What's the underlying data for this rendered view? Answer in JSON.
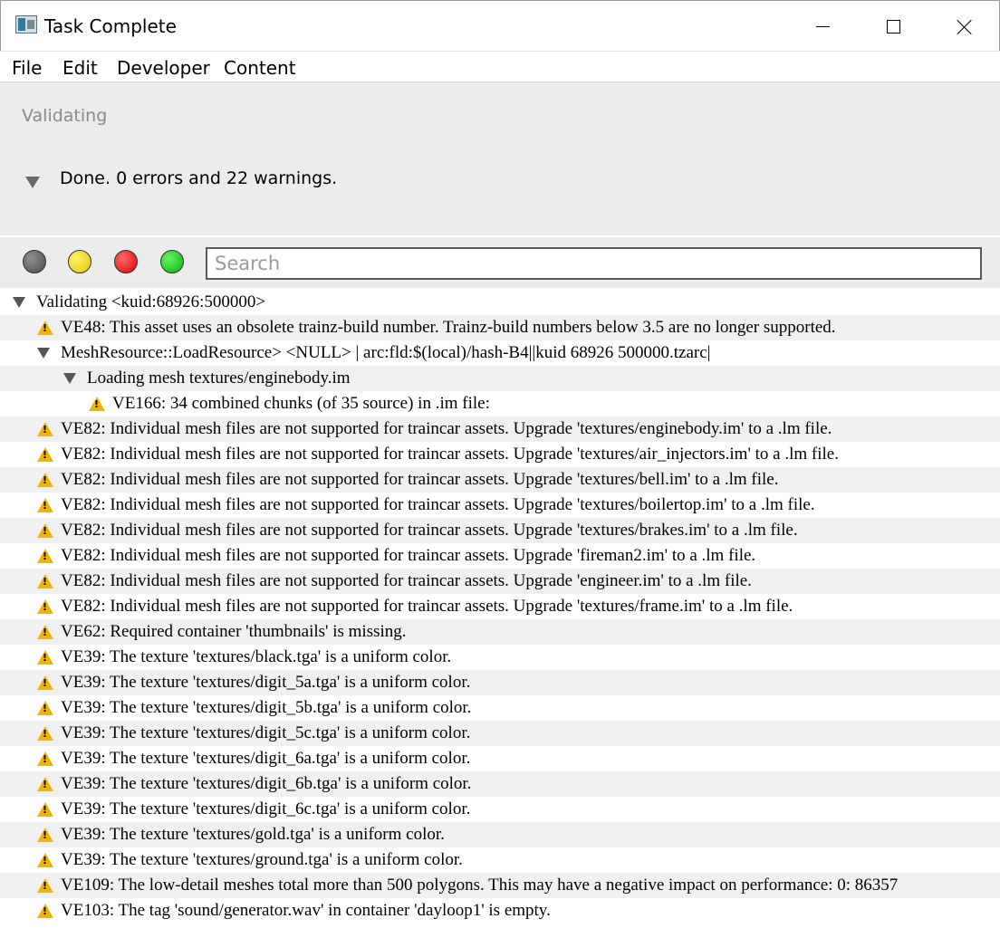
{
  "window": {
    "title": "Task Complete",
    "icon": "app-window-icon"
  },
  "menu": {
    "items": [
      "File",
      "Edit",
      "Developer",
      "Content"
    ]
  },
  "status": {
    "label": "Validating",
    "summary": "Done. 0 errors and 22 warnings."
  },
  "filters": {
    "dots": [
      {
        "name": "gray",
        "color": "#5a5a5a"
      },
      {
        "name": "yellow",
        "color": "#f2de00"
      },
      {
        "name": "red",
        "color": "#e00000"
      },
      {
        "name": "green",
        "color": "#00c800"
      }
    ],
    "search_placeholder": "Search"
  },
  "log": {
    "rows": [
      {
        "level": 0,
        "icon": "tree-expand",
        "text": "Validating <kuid:68926:500000>"
      },
      {
        "level": 1,
        "icon": "warning",
        "text": "VE48: This asset uses an obsolete trainz-build number. Trainz-build numbers below 3.5 are no longer supported."
      },
      {
        "level": 1,
        "icon": "tree-expand",
        "text": "MeshResource::LoadResource> <NULL> | arc:fld:$(local)/hash-B4||kuid 68926 500000.tzarc|"
      },
      {
        "level": 2,
        "icon": "tree-expand",
        "text": "Loading mesh textures/enginebody.im"
      },
      {
        "level": 3,
        "icon": "warning",
        "text": "VE166: 34 combined chunks (of 35 source) in .im file:"
      },
      {
        "level": 1,
        "icon": "warning",
        "text": "VE82: Individual mesh files are not supported for traincar assets. Upgrade 'textures/enginebody.im' to a .lm file."
      },
      {
        "level": 1,
        "icon": "warning",
        "text": "VE82: Individual mesh files are not supported for traincar assets. Upgrade 'textures/air_injectors.im' to a .lm file."
      },
      {
        "level": 1,
        "icon": "warning",
        "text": "VE82: Individual mesh files are not supported for traincar assets. Upgrade 'textures/bell.im' to a .lm file."
      },
      {
        "level": 1,
        "icon": "warning",
        "text": "VE82: Individual mesh files are not supported for traincar assets. Upgrade 'textures/boilertop.im' to a .lm file."
      },
      {
        "level": 1,
        "icon": "warning",
        "text": "VE82: Individual mesh files are not supported for traincar assets. Upgrade 'textures/brakes.im' to a .lm file."
      },
      {
        "level": 1,
        "icon": "warning",
        "text": "VE82: Individual mesh files are not supported for traincar assets. Upgrade 'fireman2.im' to a .lm file."
      },
      {
        "level": 1,
        "icon": "warning",
        "text": "VE82: Individual mesh files are not supported for traincar assets. Upgrade 'engineer.im' to a .lm file."
      },
      {
        "level": 1,
        "icon": "warning",
        "text": "VE82: Individual mesh files are not supported for traincar assets. Upgrade 'textures/frame.im' to a .lm file."
      },
      {
        "level": 1,
        "icon": "warning",
        "text": "VE62: Required container 'thumbnails' is missing."
      },
      {
        "level": 1,
        "icon": "warning",
        "text": "VE39: The texture 'textures/black.tga' is a uniform color."
      },
      {
        "level": 1,
        "icon": "warning",
        "text": "VE39: The texture 'textures/digit_5a.tga' is a uniform color."
      },
      {
        "level": 1,
        "icon": "warning",
        "text": "VE39: The texture 'textures/digit_5b.tga' is a uniform color."
      },
      {
        "level": 1,
        "icon": "warning",
        "text": "VE39: The texture 'textures/digit_5c.tga' is a uniform color."
      },
      {
        "level": 1,
        "icon": "warning",
        "text": "VE39: The texture 'textures/digit_6a.tga' is a uniform color."
      },
      {
        "level": 1,
        "icon": "warning",
        "text": "VE39: The texture 'textures/digit_6b.tga' is a uniform color."
      },
      {
        "level": 1,
        "icon": "warning",
        "text": "VE39: The texture 'textures/digit_6c.tga' is a uniform color."
      },
      {
        "level": 1,
        "icon": "warning",
        "text": "VE39: The texture 'textures/gold.tga' is a uniform color."
      },
      {
        "level": 1,
        "icon": "warning",
        "text": "VE39: The texture 'textures/ground.tga' is a uniform color."
      },
      {
        "level": 1,
        "icon": "warning",
        "text": "VE109: The low-detail meshes total more than 500 polygons. This may have a negative impact on performance: 0: 86357"
      },
      {
        "level": 1,
        "icon": "warning",
        "text": "VE103: The tag 'sound/generator.wav' in container 'dayloop1' is empty."
      }
    ]
  }
}
